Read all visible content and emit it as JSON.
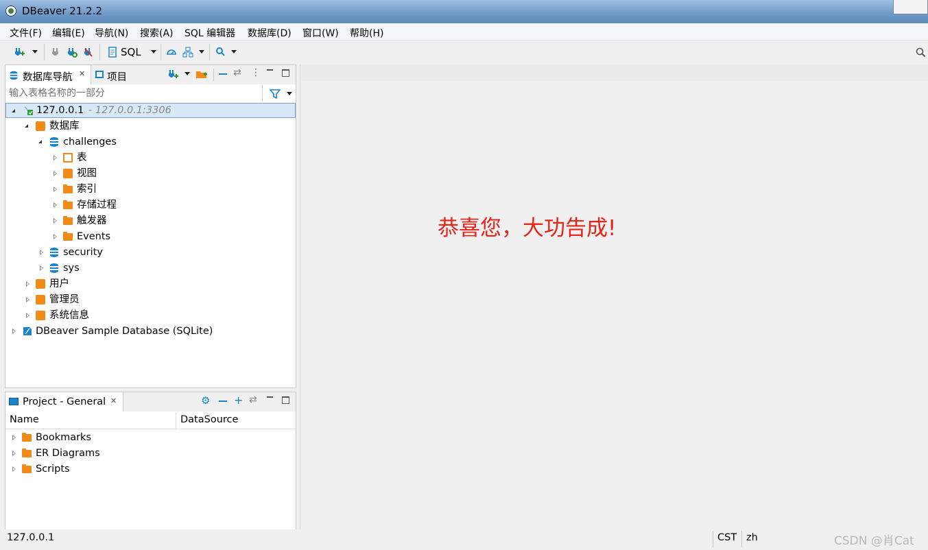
{
  "window": {
    "title": "DBeaver 21.2.2"
  },
  "menu": [
    "文件(F)",
    "编辑(E)",
    "导航(N)",
    "搜索(A)",
    "SQL 编辑器",
    "数据库(D)",
    "窗口(W)",
    "帮助(H)"
  ],
  "toolbar": {
    "sql_label": "SQL"
  },
  "navigator": {
    "tab_label": "数据库导航",
    "project_tab_label": "项目",
    "filter_placeholder": "输入表格名称的一部分",
    "tree": [
      {
        "label": "127.0.0.1",
        "suffix": "- 127.0.0.1:3306"
      },
      {
        "label": "数据库"
      },
      {
        "label": "challenges"
      },
      {
        "label": "表"
      },
      {
        "label": "视图"
      },
      {
        "label": "索引"
      },
      {
        "label": "存储过程"
      },
      {
        "label": "触发器"
      },
      {
        "label": "Events"
      },
      {
        "label": "security"
      },
      {
        "label": "sys"
      },
      {
        "label": "用户"
      },
      {
        "label": "管理员"
      },
      {
        "label": "系统信息"
      },
      {
        "label": "DBeaver Sample Database (SQLite)"
      }
    ]
  },
  "project": {
    "tab_label": "Project - General",
    "columns": [
      "Name",
      "DataSource"
    ],
    "items": [
      "Bookmarks",
      "ER Diagrams",
      "Scripts"
    ]
  },
  "editor": {
    "message": "恭喜您，大功告成!",
    "message_color": "#e8231a"
  },
  "status": {
    "connection": "127.0.0.1",
    "timezone": "CST",
    "locale": "zh",
    "watermark": "CSDN @肖Cat"
  }
}
